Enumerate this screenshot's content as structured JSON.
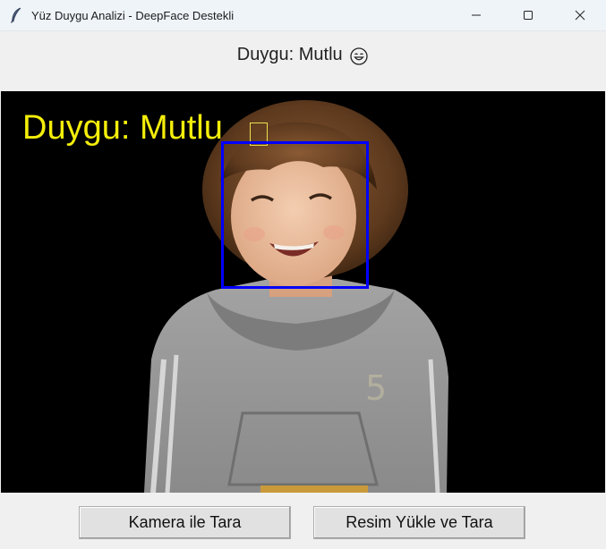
{
  "window": {
    "title": "Yüz Duygu Analizi - DeepFace Destekli",
    "icon": "feather-icon"
  },
  "header": {
    "emotion_label": "Duygu: Mutlu",
    "emoji_icon": "smiling-face-emoji"
  },
  "image_overlay": {
    "text": "Duygu: Mutlu",
    "text_color": "#f4ee0a",
    "face_box_color": "#0000ff"
  },
  "buttons": {
    "camera": "Kamera ile Tara",
    "upload": "Resim Yükle ve Tara"
  }
}
